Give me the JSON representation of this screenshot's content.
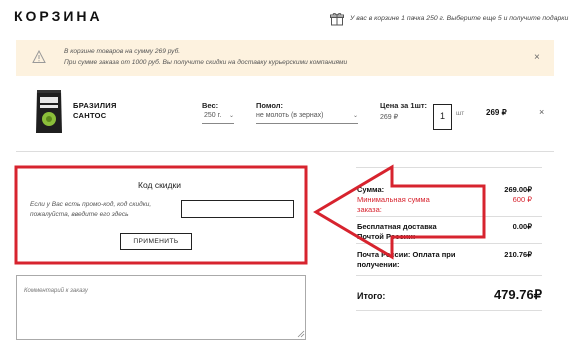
{
  "header": {
    "title": "КОРЗИНА",
    "gift_text": "У вас в корзине 1 пачка 250 г. Выберите еще 5 и получите подарки"
  },
  "notice": {
    "line1": "В корзине товаров на сумму 269 руб.",
    "line2": "При сумме заказа от 1000 руб. Вы получите скидки на доставку курьерскими компаниями",
    "close": "×"
  },
  "cart_item": {
    "name_line1": "БРАЗИЛИЯ",
    "name_line2": "САНТОС",
    "weight_label": "Вес:",
    "weight_value": "250 г.",
    "grind_label": "Помол:",
    "grind_value": "не молоть (в зернах)",
    "price_label": "Цена за 1шт:",
    "price_value": "269 ₽",
    "quantity": "1",
    "quantity_unit": "шт",
    "line_total": "269 ₽",
    "remove": "×"
  },
  "promo": {
    "title": "Код скидки",
    "hint_line1": "Если у Вас есть промо-код, код скидки,",
    "hint_line2": "пожалуйста, введите его здесь",
    "input_value": "",
    "apply_label": "ПРИМЕНИТЬ"
  },
  "comment": {
    "placeholder": "Комментарий к заказу"
  },
  "summary": {
    "sum_label": "Сумма:",
    "sum_value": "269.00₽",
    "min_label_line1": "Минимальная сумма",
    "min_label_line2": "заказа:",
    "min_value": "600 ₽",
    "delivery_line1": "Бесплатная доставка",
    "delivery_line2": "Почтой России:",
    "delivery_value": "0.00₽",
    "cod_line1": "Почта России: Оплата при",
    "cod_line2": "получении:",
    "cod_value": "210.76₽",
    "total_label": "Итого:",
    "total_value": "479.76₽"
  },
  "colors": {
    "notice_bg": "#fdf2df",
    "annotation_red": "#d7232e",
    "min_sum_red": "#d7232e"
  }
}
